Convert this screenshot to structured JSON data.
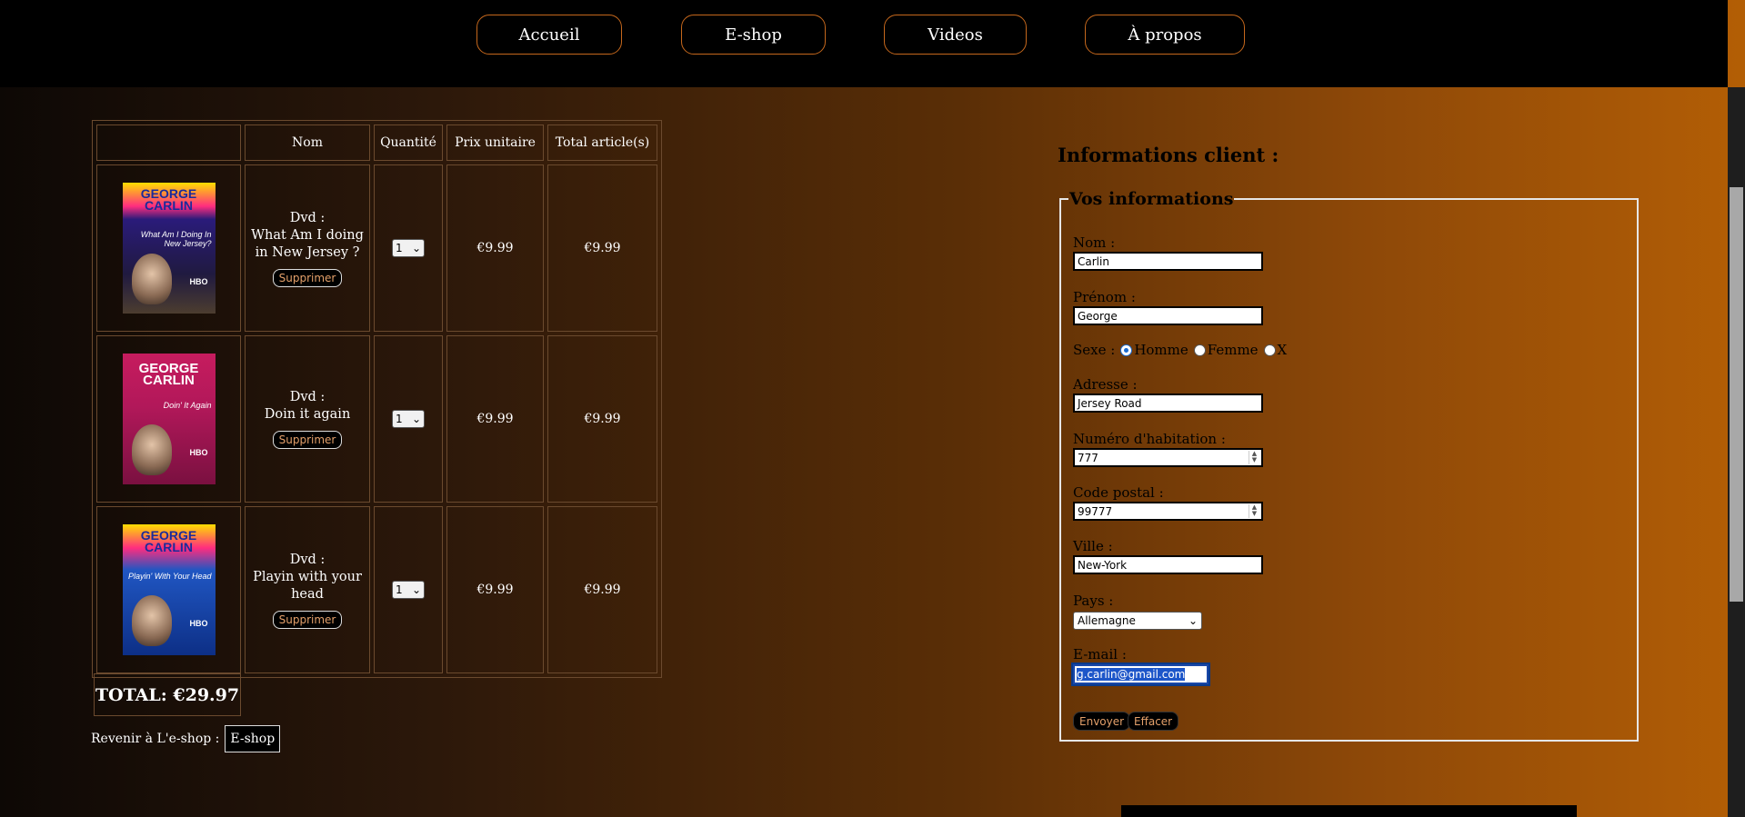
{
  "nav": {
    "items": [
      {
        "label": "Accueil"
      },
      {
        "label": "E-shop"
      },
      {
        "label": "Videos"
      },
      {
        "label": "À propos"
      }
    ]
  },
  "cart": {
    "headers": [
      "",
      "Nom",
      "Quantité",
      "Prix unitaire",
      "Total article(s)"
    ],
    "items": [
      {
        "name": "Dvd :\nWhat Am I doing in New Jersey ?",
        "qty": "1",
        "unit_price": "€9.99",
        "total": "€9.99",
        "delete_label": "Supprimer",
        "cover_title": "GEORGE CARLIN",
        "cover_subtitle": "What Am I Doing In New Jersey?",
        "cover_badge": "HBO"
      },
      {
        "name": "Dvd :\nDoin it again",
        "qty": "1",
        "unit_price": "€9.99",
        "total": "€9.99",
        "delete_label": "Supprimer",
        "cover_title": "GEORGE CARLIN",
        "cover_subtitle": "Doin' It Again",
        "cover_badge": "HBO"
      },
      {
        "name": "Dvd :\nPlayin with your head",
        "qty": "1",
        "unit_price": "€9.99",
        "total": "€9.99",
        "delete_label": "Supprimer",
        "cover_title": "GEORGE CARLIN",
        "cover_subtitle": "Playin' With Your Head",
        "cover_badge": "HBO"
      }
    ],
    "total_label": "TOTAL: €29.97",
    "back_label": "Revenir à L'e-shop :",
    "back_button": "E-shop"
  },
  "form": {
    "title": "Informations client :",
    "legend": "Vos informations",
    "nom_label": "Nom :",
    "nom_value": "Carlin",
    "prenom_label": "Prénom :",
    "prenom_value": "George",
    "sexe_label": "Sexe :",
    "sexe_options": [
      "Homme",
      "Femme",
      "X"
    ],
    "sexe_selected": "Homme",
    "adresse_label": "Adresse :",
    "adresse_value": "Jersey Road",
    "numero_label": "Numéro d'habitation :",
    "numero_value": "777",
    "postal_label": "Code postal :",
    "postal_value": "99777",
    "ville_label": "Ville :",
    "ville_value": "New-York",
    "pays_label": "Pays :",
    "pays_value": "Allemagne",
    "email_label": "E-mail :",
    "email_value": "g.carlin@gmail.com",
    "submit_label": "Envoyer",
    "reset_label": "Effacer"
  },
  "colors": {
    "accent": "#c4671c",
    "button_text": "#e4a06a",
    "selection": "#1d56c9"
  }
}
